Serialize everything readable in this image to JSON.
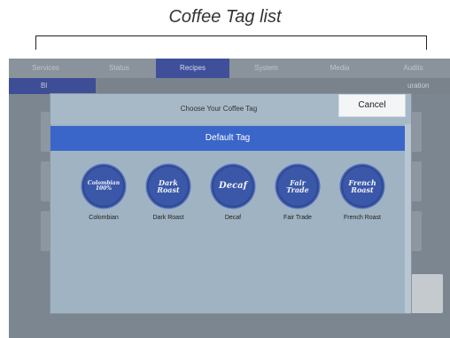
{
  "caption": "Coffee Tag list",
  "nav": {
    "tabs": [
      "Services",
      "Status",
      "Recipes",
      "System",
      "Media",
      "Audits"
    ],
    "active_tab": "Recipes",
    "sub_left": "Bl",
    "sub_right": "uration"
  },
  "modal": {
    "title": "Choose Your Coffee Tag",
    "cancel_label": "Cancel",
    "section_header": "Default Tag",
    "tags": [
      {
        "badge_line1": "Colombian",
        "badge_line2": "100%",
        "label": "Colombian"
      },
      {
        "badge_line1": "Dark",
        "badge_line2": "Roast",
        "label": "Dark Roast"
      },
      {
        "badge_line1": "Decaf",
        "badge_line2": "",
        "label": "Decaf"
      },
      {
        "badge_line1": "Fair",
        "badge_line2": "Trade",
        "label": "Fair Trade"
      },
      {
        "badge_line1": "French",
        "badge_line2": "Roast",
        "label": "French Roast"
      }
    ]
  },
  "colors": {
    "nav_active": "#3f4f9a",
    "section_header": "#3a66c9",
    "badge": "#3a57a8",
    "modal_bg": "#9fb3c2"
  }
}
